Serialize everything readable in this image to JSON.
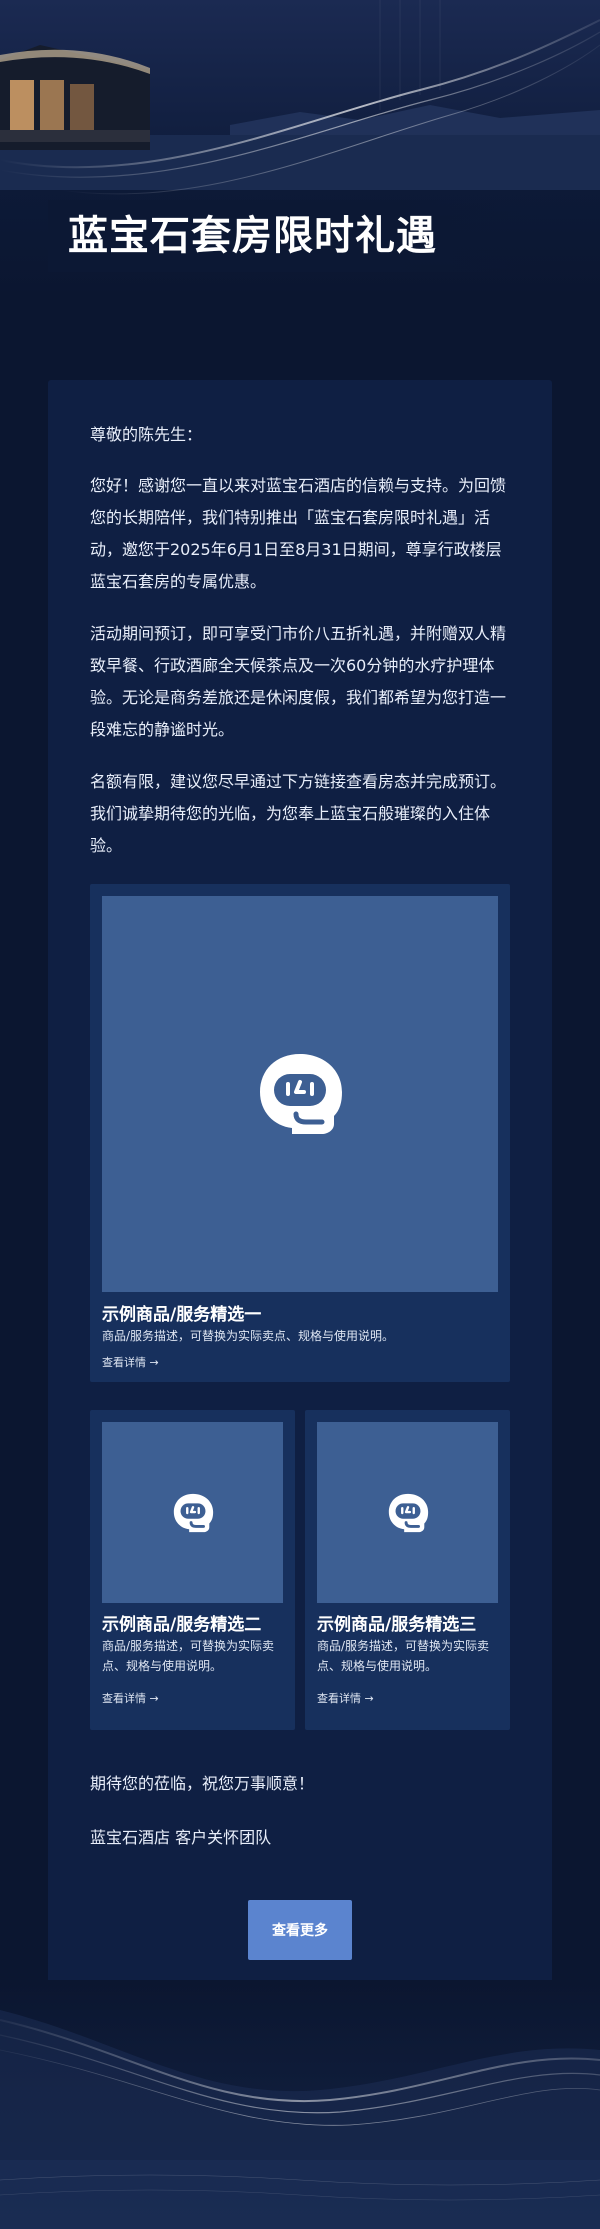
{
  "hero": {
    "title": "蓝宝石套房限时礼遇"
  },
  "letter": {
    "greeting": "尊敬的陈先生：",
    "paragraphs": [
      "您好！感谢您一直以来对蓝宝石酒店的信赖与支持。为回馈您的长期陪伴，我们特别推出「蓝宝石套房限时礼遇」活动，邀您于2025年6月1日至8月31日期间，尊享行政楼层蓝宝石套房的专属优惠。",
      "活动期间预订，即可享受门市价八五折礼遇，并附赠双人精致早餐、行政酒廊全天候茶点及一次60分钟的水疗护理体验。无论是商务差旅还是休闲度假，我们都希望为您打造一段难忘的静谧时光。",
      "名额有限，建议您尽早通过下方链接查看房态并完成预订。我们诚挚期待您的光临，为您奉上蓝宝石般璀璨的入住体验。"
    ],
    "closing": "期待您的莅临，祝您万事顺意！",
    "signature": "蓝宝石酒店 客户关怀团队"
  },
  "products": [
    {
      "title": "示例商品/服务精选一",
      "desc": "商品/服务描述，可替换为实际卖点、规格与使用说明。",
      "link": "查看详情 →",
      "icon": "robot-face-icon"
    },
    {
      "title": "示例商品/服务精选二",
      "desc": "商品/服务描述，可替换为实际卖点、规格与使用说明。",
      "link": "查看详情 →",
      "icon": "robot-face-icon"
    },
    {
      "title": "示例商品/服务精选三",
      "desc": "商品/服务描述，可替换为实际卖点、规格与使用说明。",
      "link": "查看详情 →",
      "icon": "robot-face-icon"
    }
  ],
  "cta": {
    "label": "查看更多"
  },
  "colors": {
    "background": "#0b1630",
    "card": "#0f1f43",
    "product_card": "#17305d",
    "image_placeholder": "#3d5f93",
    "button": "#5b84cf"
  }
}
